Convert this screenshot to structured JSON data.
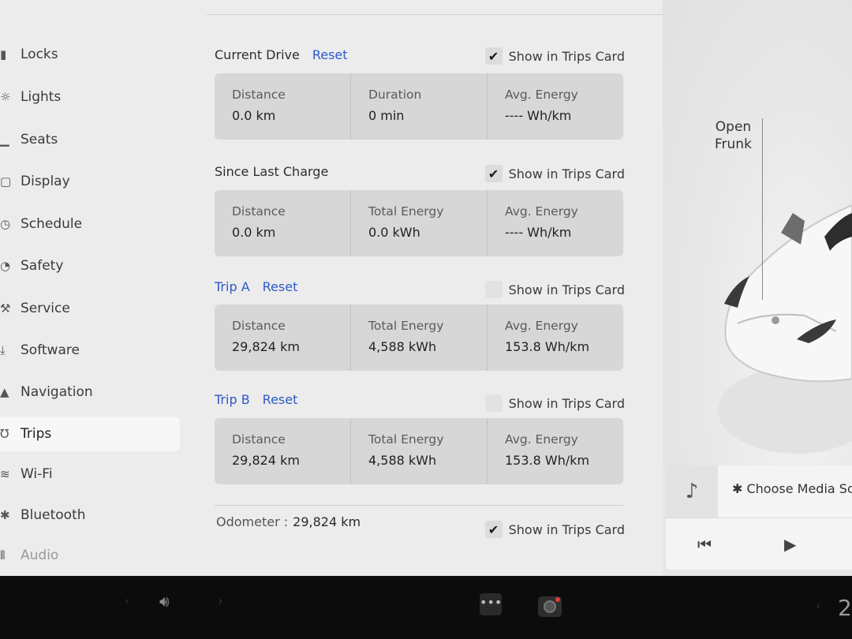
{
  "sidebar": {
    "items": [
      {
        "icon": "lock-icon",
        "glyph": "▮",
        "label": "Locks"
      },
      {
        "icon": "lights-icon",
        "glyph": "☼",
        "label": "Lights"
      },
      {
        "icon": "seat-icon",
        "glyph": "▁",
        "label": "Seats"
      },
      {
        "icon": "display-icon",
        "glyph": "▢",
        "label": "Display"
      },
      {
        "icon": "schedule-icon",
        "glyph": "◷",
        "label": "Schedule"
      },
      {
        "icon": "safety-icon",
        "glyph": "◔",
        "label": "Safety"
      },
      {
        "icon": "wrench-icon",
        "glyph": "⚒",
        "label": "Service"
      },
      {
        "icon": "download-icon",
        "glyph": "⤓",
        "label": "Software"
      },
      {
        "icon": "navigation-icon",
        "glyph": "▲",
        "label": "Navigation"
      },
      {
        "icon": "trips-icon",
        "glyph": "Ʊ",
        "label": "Trips"
      },
      {
        "icon": "wifi-icon",
        "glyph": "≋",
        "label": "Wi-Fi"
      },
      {
        "icon": "bluetooth-icon",
        "glyph": "✱",
        "label": "Bluetooth"
      },
      {
        "icon": "audio-icon",
        "glyph": "⦀",
        "label": "Audio"
      }
    ],
    "active": "Trips"
  },
  "current_drive": {
    "title": "Current Drive",
    "reset": "Reset",
    "show_card": "Show in Trips Card",
    "checked": true,
    "cells": [
      {
        "label": "Distance",
        "value": "0.0  km"
      },
      {
        "label": "Duration",
        "value": "0  min"
      },
      {
        "label": "Avg. Energy",
        "value": "----  Wh/km"
      }
    ]
  },
  "since_charge": {
    "title": "Since Last Charge",
    "show_card": "Show in Trips Card",
    "checked": true,
    "cells": [
      {
        "label": "Distance",
        "value": "0.0  km"
      },
      {
        "label": "Total Energy",
        "value": "0.0  kWh"
      },
      {
        "label": "Avg. Energy",
        "value": "----  Wh/km"
      }
    ]
  },
  "trip_a": {
    "title": "Trip A",
    "reset": "Reset",
    "show_card": "Show in Trips Card",
    "checked": false,
    "cells": [
      {
        "label": "Distance",
        "value": "29,824  km"
      },
      {
        "label": "Total Energy",
        "value": "4,588  kWh"
      },
      {
        "label": "Avg. Energy",
        "value": "153.8  Wh/km"
      }
    ]
  },
  "trip_b": {
    "title": "Trip B",
    "reset": "Reset",
    "show_card": "Show in Trips Card",
    "checked": false,
    "cells": [
      {
        "label": "Distance",
        "value": "29,824  km"
      },
      {
        "label": "Total Energy",
        "value": "4,588  kWh"
      },
      {
        "label": "Avg. Energy",
        "value": "153.8  Wh/km"
      }
    ]
  },
  "odometer": {
    "label": "Odometer  :",
    "value": "29,824  km",
    "show_card": "Show in Trips Card",
    "checked": true
  },
  "car_panel": {
    "frunk_line1": "Open",
    "frunk_line2": "Frunk"
  },
  "media": {
    "source_label": "✱ Choose Media So",
    "note_icon": "music-note-icon",
    "prev_icon": "previous-track-icon",
    "play_icon": "play-icon"
  },
  "bottom_bar": {
    "volume_icon": "volume-icon",
    "apps_icon": "more-apps-icon",
    "camera_icon": "camera-icon",
    "temp_fragment": "2"
  }
}
